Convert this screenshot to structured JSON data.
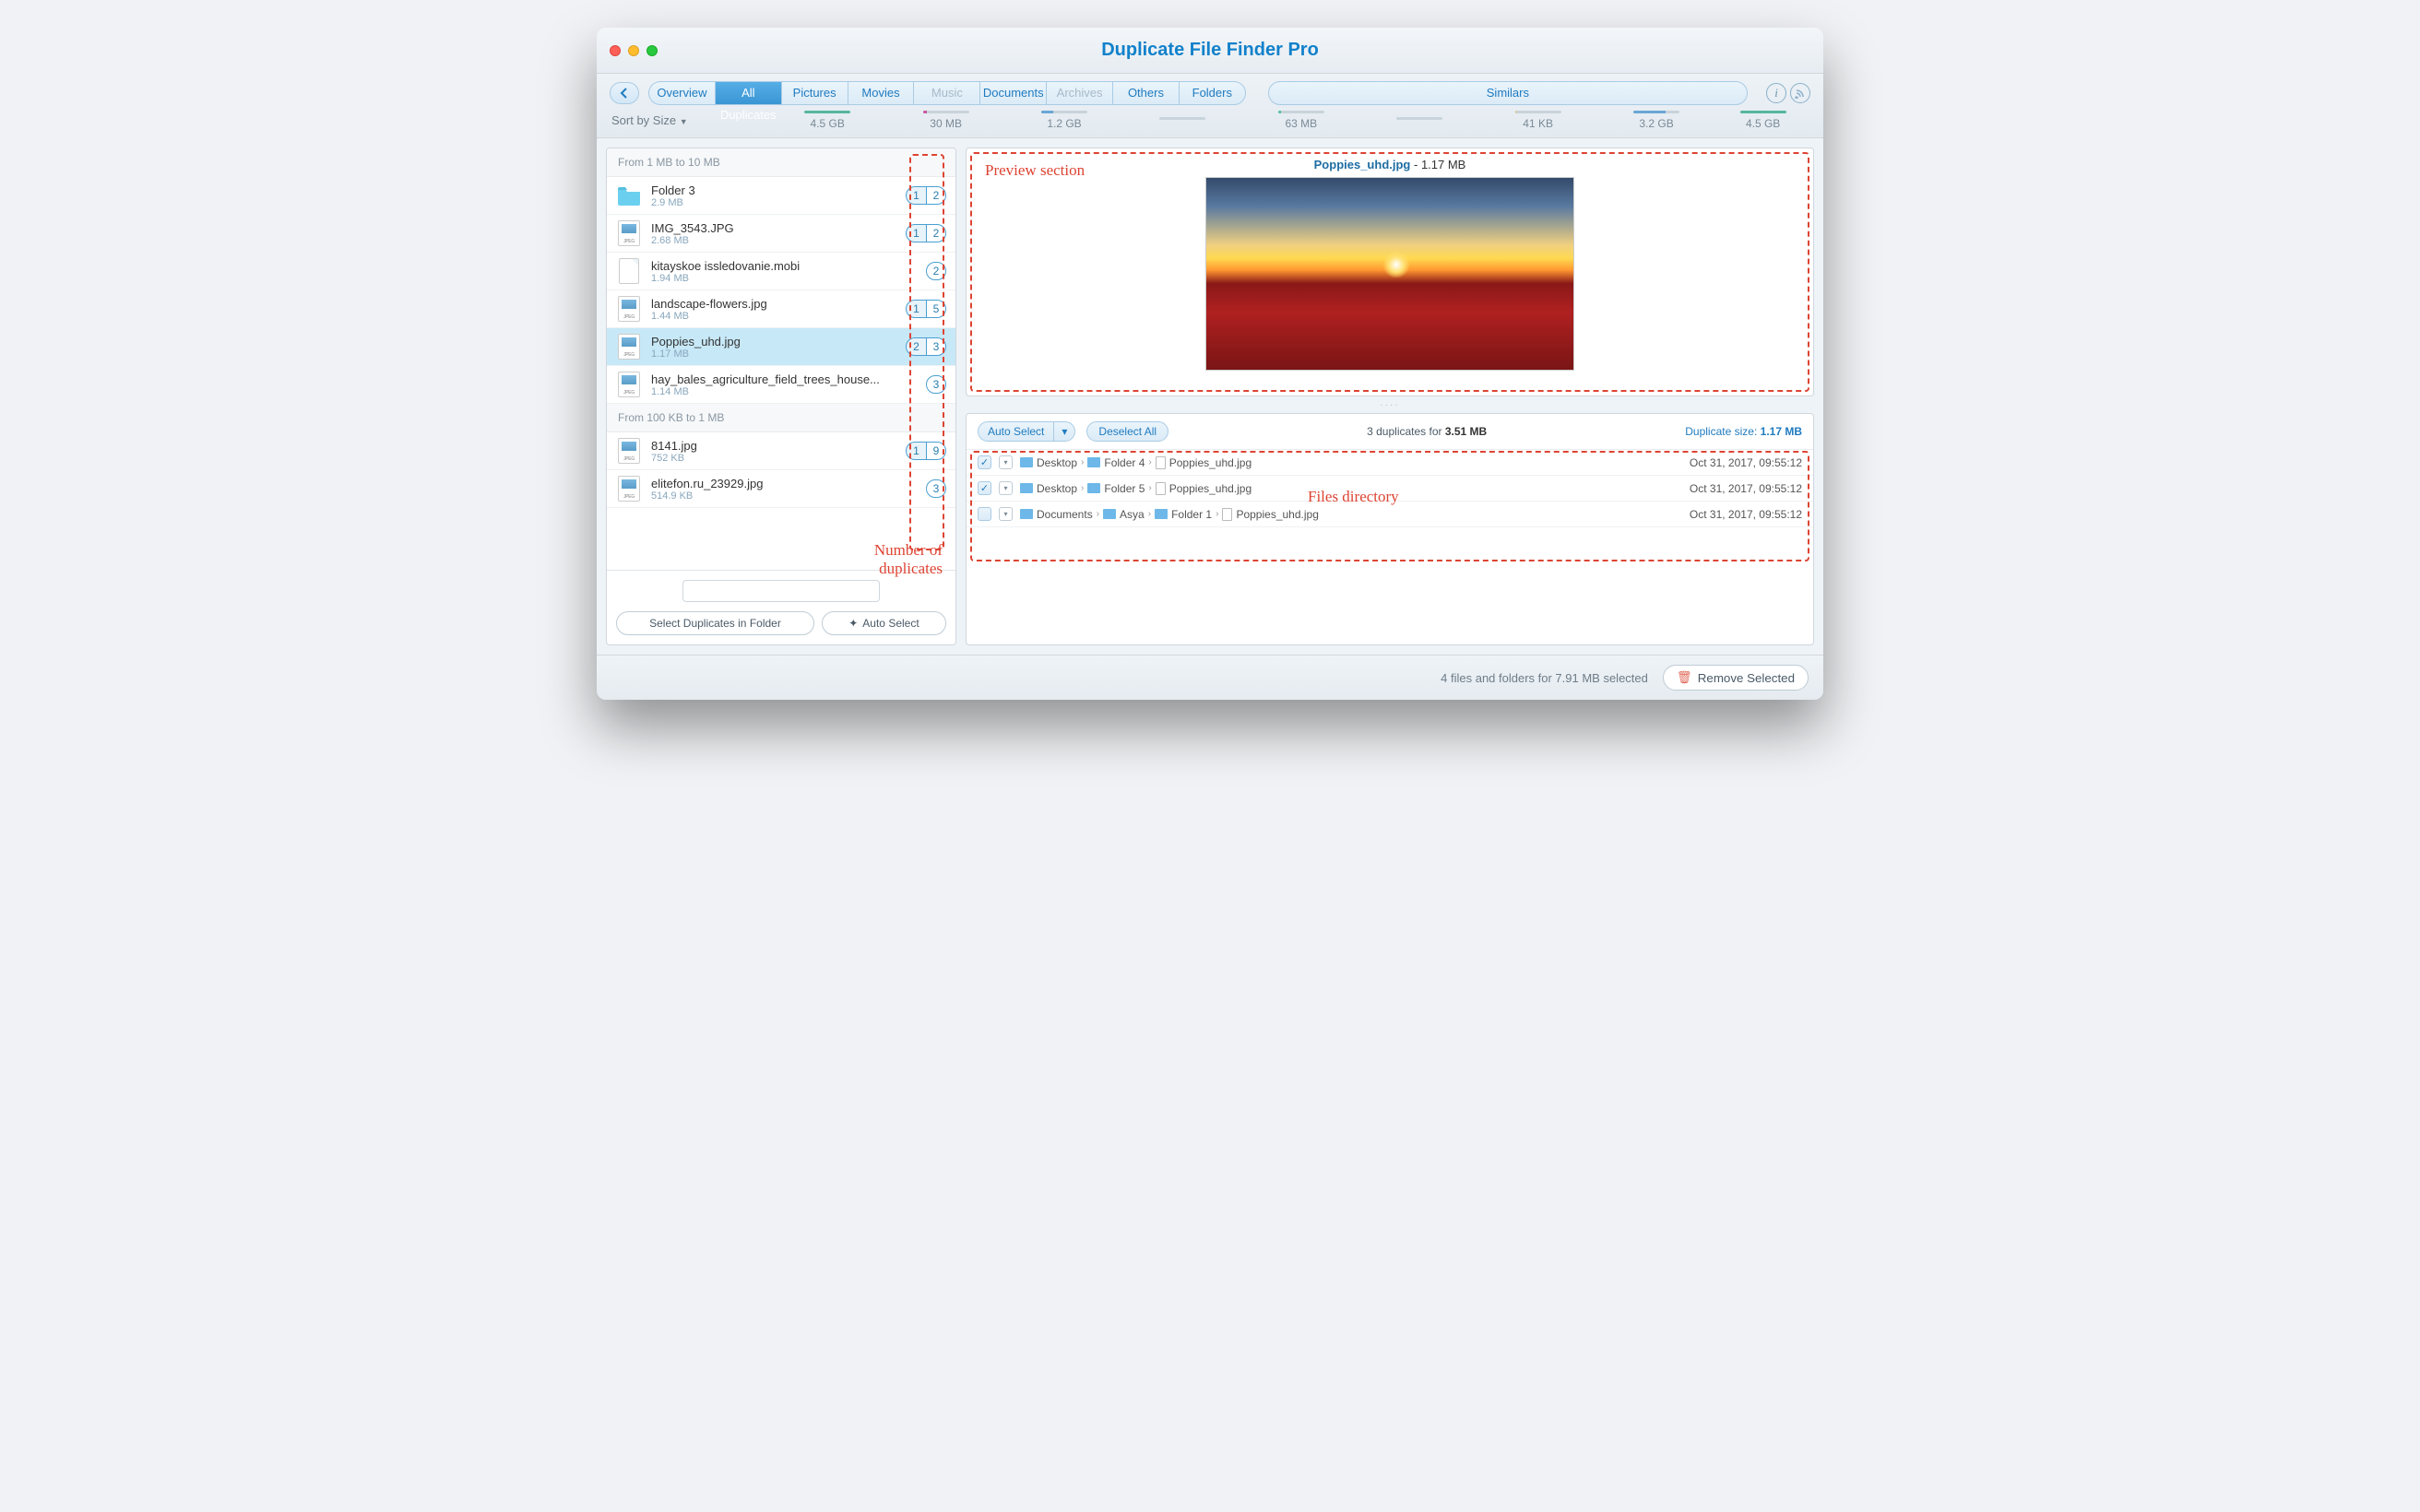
{
  "app_title": "Duplicate File Finder Pro",
  "tabs": [
    {
      "label": "Overview"
    },
    {
      "label": "All Duplicates",
      "active": true,
      "size": "4.5 GB",
      "bar": 100,
      "color": "#56b6a0"
    },
    {
      "label": "Pictures",
      "size": "30 MB",
      "bar": 8,
      "color": "#c858a0"
    },
    {
      "label": "Movies",
      "size": "1.2 GB",
      "bar": 25,
      "color": "#6aa6d6"
    },
    {
      "label": "Music",
      "size": "",
      "bar": 0,
      "disabled": true
    },
    {
      "label": "Documents",
      "size": "63 MB",
      "bar": 6,
      "color": "#5bbfa0"
    },
    {
      "label": "Archives",
      "size": "",
      "bar": 0,
      "disabled": true
    },
    {
      "label": "Others",
      "size": "41 KB",
      "bar": 2,
      "color": "#e6c25a"
    },
    {
      "label": "Folders",
      "size": "3.2 GB",
      "bar": 70,
      "color": "#6aa6d6"
    }
  ],
  "similars_tab": {
    "label": "Similars",
    "size": "4.5 GB",
    "bar": 100,
    "color": "#56b6a0"
  },
  "sort_label": "Sort by Size",
  "groups": [
    {
      "header": "From 1 MB to 10 MB",
      "items": [
        {
          "name": "Folder 3",
          "size": "2.9 MB",
          "icon": "folder",
          "badges": [
            1,
            2
          ]
        },
        {
          "name": "IMG_3543.JPG",
          "size": "2.68 MB",
          "icon": "jpeg",
          "badges": [
            1,
            2
          ]
        },
        {
          "name": "kitayskoe issledovanie.mobi",
          "size": "1.94 MB",
          "icon": "doc",
          "badges": [
            2
          ]
        },
        {
          "name": "landscape-flowers.jpg",
          "size": "1.44 MB",
          "icon": "jpeg",
          "badges": [
            1,
            5
          ]
        },
        {
          "name": "Poppies_uhd.jpg",
          "size": "1.17 MB",
          "icon": "jpeg",
          "badges": [
            2,
            3
          ],
          "selected": true
        },
        {
          "name": "hay_bales_agriculture_field_trees_house...",
          "size": "1.14 MB",
          "icon": "jpeg",
          "badges": [
            3
          ]
        }
      ]
    },
    {
      "header": "From 100 KB to 1 MB",
      "items": [
        {
          "name": "8141.jpg",
          "size": "752 KB",
          "icon": "jpeg",
          "badges": [
            1,
            9
          ]
        },
        {
          "name": "elitefon.ru_23929.jpg",
          "size": "514.9 KB",
          "icon": "jpeg",
          "badges": [
            3
          ]
        }
      ]
    }
  ],
  "select_in_folder": "Select Duplicates in Folder",
  "auto_select_sidebar": "Auto Select",
  "preview": {
    "name": "Poppies_uhd.jpg",
    "size": "1.17 MB"
  },
  "detail_toolbar": {
    "auto_select": "Auto Select",
    "deselect": "Deselect All",
    "summary_count": "3 duplicates for",
    "summary_size": "3.51 MB",
    "dup_label": "Duplicate size:",
    "dup_size": "1.17 MB"
  },
  "paths": [
    {
      "checked": true,
      "crumbs": [
        "Desktop",
        "Folder 4",
        "Poppies_uhd.jpg"
      ],
      "ts": "Oct 31, 2017, 09:55:12"
    },
    {
      "checked": true,
      "crumbs": [
        "Desktop",
        "Folder 5",
        "Poppies_uhd.jpg"
      ],
      "ts": "Oct 31, 2017, 09:55:12"
    },
    {
      "checked": false,
      "crumbs": [
        "Documents",
        "Asya",
        "Folder 1",
        "Poppies_uhd.jpg"
      ],
      "ts": "Oct 31, 2017, 09:55:12"
    }
  ],
  "footer": {
    "status": "4 files and folders for 7.91 MB selected",
    "remove": "Remove Selected"
  },
  "annotations": {
    "preview": "Preview section",
    "files_dir": "Files directory",
    "num_dup": "Number of\nduplicates"
  }
}
